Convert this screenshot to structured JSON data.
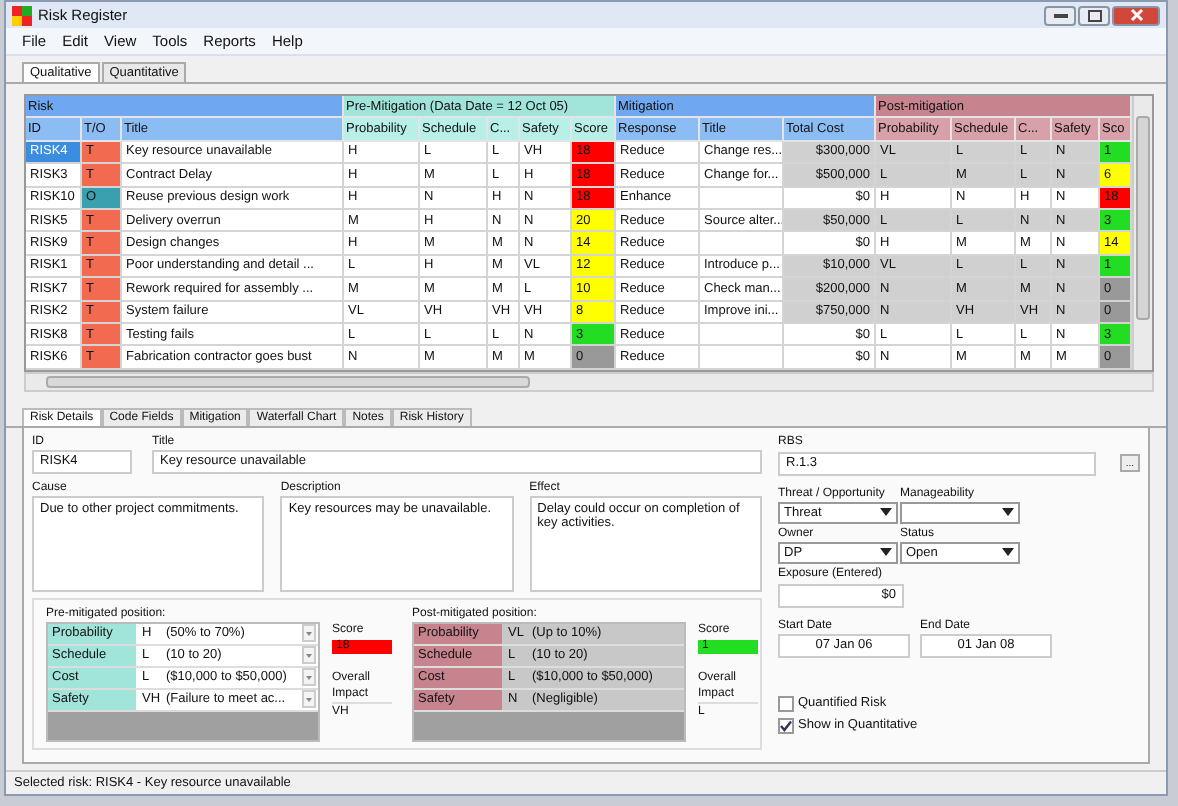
{
  "window": {
    "title": "Risk Register"
  },
  "menu": [
    "File",
    "Edit",
    "View",
    "Tools",
    "Reports",
    "Help"
  ],
  "view_tabs": [
    {
      "label": "Qualitative",
      "selected": true
    },
    {
      "label": "Quantitative",
      "selected": false
    }
  ],
  "grid": {
    "groups": [
      {
        "label": "Risk",
        "kind": "risk"
      },
      {
        "label": "Pre-Mitigation (Data Date = 12 Oct 05)",
        "kind": "pre"
      },
      {
        "label": "Mitigation",
        "kind": "mit"
      },
      {
        "label": "Post-mitigation",
        "kind": "post"
      }
    ],
    "columns": [
      {
        "label": "ID",
        "kind": "risk"
      },
      {
        "label": "T/O",
        "kind": "risk"
      },
      {
        "label": "Title",
        "kind": "risk"
      },
      {
        "label": "Probability",
        "kind": "pre"
      },
      {
        "label": "Schedule",
        "kind": "pre"
      },
      {
        "label": "C...",
        "kind": "pre"
      },
      {
        "label": "Safety",
        "kind": "pre"
      },
      {
        "label": "Score",
        "kind": "pre"
      },
      {
        "label": "Response",
        "kind": "mit"
      },
      {
        "label": "Title",
        "kind": "mit"
      },
      {
        "label": "Total Cost",
        "kind": "mit"
      },
      {
        "label": "Probability",
        "kind": "post"
      },
      {
        "label": "Schedule",
        "kind": "post"
      },
      {
        "label": "C...",
        "kind": "post"
      },
      {
        "label": "Safety",
        "kind": "post"
      },
      {
        "label": "Sco",
        "kind": "post"
      }
    ],
    "rows": [
      {
        "selected": true,
        "mitigated": true,
        "id": "RISK4",
        "t_o": {
          "value": "T",
          "color": "#f26b50"
        },
        "title": "Key resource unavailable",
        "pre": [
          "H",
          "L",
          "L",
          "VH"
        ],
        "pre_score": {
          "value": "18",
          "color": "#ff0000"
        },
        "response": "Reduce",
        "mit_title": "Change res...",
        "cost": "$300,000",
        "post": [
          "VL",
          "L",
          "L",
          "N"
        ],
        "post_score": {
          "value": "1",
          "color": "#22dd22"
        }
      },
      {
        "selected": false,
        "mitigated": true,
        "id": "RISK3",
        "t_o": {
          "value": "T",
          "color": "#f26b50"
        },
        "title": "Contract Delay",
        "pre": [
          "H",
          "M",
          "L",
          "H"
        ],
        "pre_score": {
          "value": "18",
          "color": "#ff0000"
        },
        "response": "Reduce",
        "mit_title": "Change for...",
        "cost": "$500,000",
        "post": [
          "L",
          "M",
          "L",
          "N"
        ],
        "post_score": {
          "value": "6",
          "color": "#ffff00"
        }
      },
      {
        "selected": false,
        "mitigated": false,
        "id": "RISK10",
        "t_o": {
          "value": "O",
          "color": "#3aa0b0"
        },
        "title": "Reuse previous design work",
        "pre": [
          "H",
          "N",
          "H",
          "N"
        ],
        "pre_score": {
          "value": "18",
          "color": "#ff0000"
        },
        "response": "Enhance",
        "cost": "$0",
        "post": [
          "H",
          "N",
          "H",
          "N"
        ],
        "post_score": {
          "value": "18",
          "color": "#ff0000"
        }
      },
      {
        "selected": false,
        "mitigated": true,
        "id": "RISK5",
        "t_o": {
          "value": "T",
          "color": "#f26b50"
        },
        "title": "Delivery overrun",
        "pre": [
          "M",
          "H",
          "N",
          "N"
        ],
        "pre_score": {
          "value": "20",
          "color": "#ffff00"
        },
        "response": "Reduce",
        "mit_title": "Source alter...",
        "cost": "$50,000",
        "post": [
          "L",
          "L",
          "N",
          "N"
        ],
        "post_score": {
          "value": "3",
          "color": "#22dd22"
        }
      },
      {
        "selected": false,
        "mitigated": false,
        "id": "RISK9",
        "t_o": {
          "value": "T",
          "color": "#f26b50"
        },
        "title": "Design changes",
        "pre": [
          "H",
          "M",
          "M",
          "N"
        ],
        "pre_score": {
          "value": "14",
          "color": "#ffff00"
        },
        "response": "Reduce",
        "cost": "$0",
        "post": [
          "H",
          "M",
          "M",
          "N"
        ],
        "post_score": {
          "value": "14",
          "color": "#ffff00"
        }
      },
      {
        "selected": false,
        "mitigated": true,
        "id": "RISK1",
        "t_o": {
          "value": "T",
          "color": "#f26b50"
        },
        "title": "Poor understanding and detail ...",
        "pre": [
          "L",
          "H",
          "M",
          "VL"
        ],
        "pre_score": {
          "value": "12",
          "color": "#ffff00"
        },
        "response": "Reduce",
        "mit_title": "Introduce p...",
        "cost": "$10,000",
        "post": [
          "VL",
          "L",
          "L",
          "N"
        ],
        "post_score": {
          "value": "1",
          "color": "#22dd22"
        }
      },
      {
        "selected": false,
        "mitigated": true,
        "id": "RISK7",
        "t_o": {
          "value": "T",
          "color": "#f26b50"
        },
        "title": "Rework required for assembly ...",
        "pre": [
          "M",
          "M",
          "M",
          "L"
        ],
        "pre_score": {
          "value": "10",
          "color": "#ffff00"
        },
        "response": "Reduce",
        "mit_title": "Check man...",
        "cost": "$200,000",
        "post": [
          "N",
          "M",
          "M",
          "N"
        ],
        "post_score": {
          "value": "0",
          "color": "#999999"
        }
      },
      {
        "selected": false,
        "mitigated": true,
        "id": "RISK2",
        "t_o": {
          "value": "T",
          "color": "#f26b50"
        },
        "title": "System failure",
        "pre": [
          "VL",
          "VH",
          "VH",
          "VH"
        ],
        "pre_score": {
          "value": "8",
          "color": "#ffff00"
        },
        "response": "Reduce",
        "mit_title": "Improve ini...",
        "cost": "$750,000",
        "post": [
          "N",
          "VH",
          "VH",
          "N"
        ],
        "post_score": {
          "value": "0",
          "color": "#999999"
        }
      },
      {
        "selected": false,
        "mitigated": false,
        "id": "RISK8",
        "t_o": {
          "value": "T",
          "color": "#f26b50"
        },
        "title": "Testing fails",
        "pre": [
          "L",
          "L",
          "L",
          "N"
        ],
        "pre_score": {
          "value": "3",
          "color": "#22dd22"
        },
        "response": "Reduce",
        "cost": "$0",
        "post": [
          "L",
          "L",
          "L",
          "N"
        ],
        "post_score": {
          "value": "3",
          "color": "#22dd22"
        }
      },
      {
        "selected": false,
        "mitigated": false,
        "id": "RISK6",
        "t_o": {
          "value": "T",
          "color": "#f26b50"
        },
        "title": "Fabrication contractor goes bust",
        "pre": [
          "N",
          "M",
          "M",
          "M"
        ],
        "pre_score": {
          "value": "0",
          "color": "#999999"
        },
        "response": "Reduce",
        "cost": "$0",
        "post": [
          "N",
          "M",
          "M",
          "M"
        ],
        "post_score": {
          "value": "0",
          "color": "#999999"
        }
      }
    ]
  },
  "detail_tabs": [
    {
      "label": "Risk Details",
      "selected": true
    },
    {
      "label": "Code Fields",
      "selected": false
    },
    {
      "label": "Mitigation",
      "selected": false
    },
    {
      "label": "Waterfall Chart",
      "selected": false
    },
    {
      "label": "Notes",
      "selected": false
    },
    {
      "label": "Risk History",
      "selected": false
    }
  ],
  "details": {
    "id_label": "ID",
    "id": "RISK4",
    "title_label": "Title",
    "title": "Key resource unavailable",
    "rbs_label": "RBS",
    "rbs": "R.1.3",
    "rbs_button": "...",
    "texts": [
      {
        "label": "Cause",
        "value": "Due to other project commitments."
      },
      {
        "label": "Description",
        "value": "Key resources may be unavailable."
      },
      {
        "label": "Effect",
        "value": "Delay could occur on completion of key activities."
      }
    ],
    "dropdowns": [
      {
        "label": "Threat / Opportunity",
        "value": "Threat"
      },
      {
        "label": "Manageability"
      },
      {
        "label": "Owner",
        "value": "DP"
      },
      {
        "label": "Status",
        "value": "Open"
      }
    ],
    "exposure_label": "Exposure (Entered)",
    "exposure": "$0",
    "dates": [
      {
        "label": "Start Date",
        "value": "07 Jan 06"
      },
      {
        "label": "End Date",
        "value": "01 Jan 08"
      }
    ],
    "positions": [
      {
        "kind": "pre",
        "disabled": false,
        "heading": "Pre-mitigated position:",
        "rows": [
          {
            "label": "Probability",
            "code": "H",
            "text": "(50% to 70%)"
          },
          {
            "label": "Schedule",
            "code": "L",
            "text": "(10 to 20)"
          },
          {
            "label": "Cost",
            "code": "L",
            "text": "($10,000 to $50,000)"
          },
          {
            "label": "Safety",
            "code": "VH",
            "text": "(Failure to meet ac..."
          }
        ],
        "score_label": "Score",
        "score": {
          "value": "18",
          "color": "#ff0000"
        },
        "impact_label": "Overall Impact",
        "impact": "VH"
      },
      {
        "kind": "post",
        "disabled": true,
        "heading": "Post-mitigated position:",
        "rows": [
          {
            "label": "Probability",
            "code": "VL",
            "text": "(Up to 10%)"
          },
          {
            "label": "Schedule",
            "code": "L",
            "text": "(10 to 20)"
          },
          {
            "label": "Cost",
            "code": "L",
            "text": "($10,000 to $50,000)"
          },
          {
            "label": "Safety",
            "code": "N",
            "text": "(Negligible)"
          }
        ],
        "score_label": "Score",
        "score": {
          "value": "1",
          "color": "#22dd22"
        },
        "impact_label": "Overall Impact",
        "impact": "L"
      }
    ],
    "checkboxes": [
      {
        "label": "Quantified Risk",
        "checked": false
      },
      {
        "label": "Show in Quantitative",
        "checked": true
      }
    ]
  },
  "status_bar": "Selected risk: RISK4 - Key resource unavailable"
}
